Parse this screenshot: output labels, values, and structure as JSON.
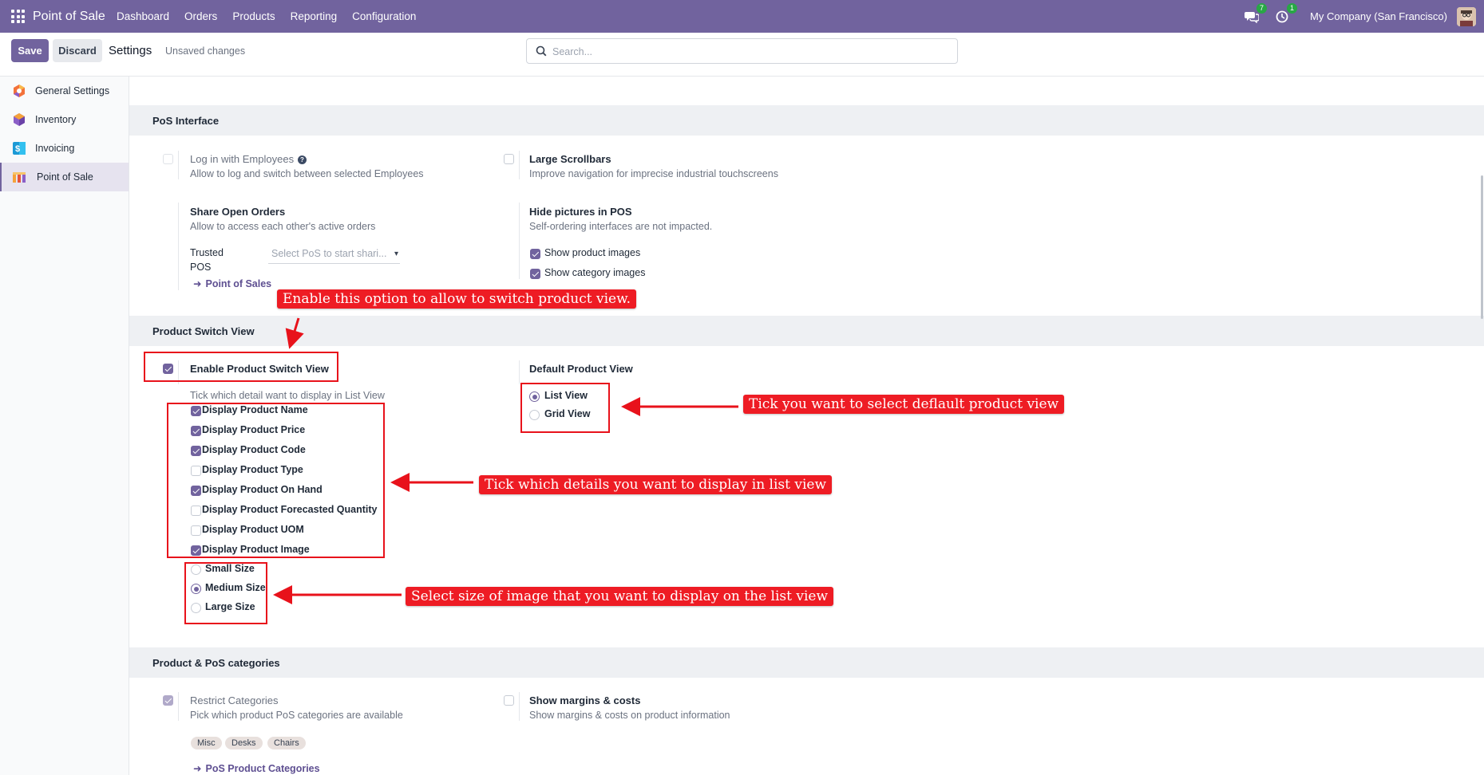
{
  "navbar": {
    "brand": "Point of Sale",
    "menu": [
      "Dashboard",
      "Orders",
      "Products",
      "Reporting",
      "Configuration"
    ],
    "messages_count": "7",
    "activities_count": "1",
    "company": "My Company (San Francisco)"
  },
  "control_panel": {
    "save_label": "Save",
    "discard_label": "Discard",
    "title": "Settings",
    "status": "Unsaved changes",
    "search_placeholder": "Search..."
  },
  "sidebar": {
    "items": [
      {
        "label": "General Settings",
        "icon": "odoo-settings-icon",
        "active": false
      },
      {
        "label": "Inventory",
        "icon": "inventory-icon",
        "active": false
      },
      {
        "label": "Invoicing",
        "icon": "invoicing-icon",
        "active": false
      },
      {
        "label": "Point of Sale",
        "icon": "point-of-sale-icon",
        "active": true
      }
    ]
  },
  "pos_interface": {
    "title": "PoS Interface",
    "login_employees": {
      "label": "Log in with Employees",
      "desc": "Allow to log and switch between selected Employees",
      "checked": false
    },
    "large_scrollbars": {
      "label": "Large Scrollbars",
      "desc": "Improve navigation for imprecise industrial touchscreens",
      "checked": false
    },
    "share_orders": {
      "label": "Share Open Orders",
      "desc": "Allow to access each other's active orders"
    },
    "trusted_pos_label_1": "Trusted",
    "trusted_pos_label_2": "POS",
    "trusted_pos_placeholder": "Select PoS to start shari...",
    "point_of_sales_link": "Point of Sales",
    "hide_pictures": {
      "label": "Hide pictures in POS",
      "desc": "Self-ordering interfaces are not impacted."
    },
    "show_product_images": {
      "label": "Show product images",
      "checked": true
    },
    "show_category_images": {
      "label": "Show category images",
      "checked": true
    }
  },
  "product_switch_view": {
    "title": "Product Switch View",
    "enable": {
      "label": "Enable Product Switch View",
      "checked": true
    },
    "list_hint": "Tick which detail want to display in List View",
    "details": [
      {
        "label": "Display Product Name",
        "checked": true
      },
      {
        "label": "Display Product Price",
        "checked": true
      },
      {
        "label": "Display Product Code",
        "checked": true
      },
      {
        "label": "Display Product Type",
        "checked": false
      },
      {
        "label": "Display Product On Hand",
        "checked": true
      },
      {
        "label": "Display Product Forecasted Quantity",
        "checked": false
      },
      {
        "label": "Display Product UOM",
        "checked": false
      },
      {
        "label": "Display Product Image",
        "checked": true
      }
    ],
    "image_sizes": [
      {
        "label": "Small Size",
        "selected": false
      },
      {
        "label": "Medium Size",
        "selected": true
      },
      {
        "label": "Large Size",
        "selected": false
      }
    ],
    "default_view": {
      "label": "Default Product View",
      "options": [
        {
          "label": "List View",
          "selected": true
        },
        {
          "label": "Grid View",
          "selected": false
        }
      ]
    }
  },
  "categories": {
    "title": "Product & PoS categories",
    "restrict": {
      "label": "Restrict Categories",
      "desc": "Pick which product PoS categories are available",
      "checked": true
    },
    "tags": [
      "Misc",
      "Desks",
      "Chairs"
    ],
    "link": "PoS Product Categories",
    "margins": {
      "label": "Show margins & costs",
      "desc": "Show margins & costs on product information",
      "checked": false
    }
  },
  "annotations": {
    "enable_option": "Enable this option to allow to switch product view.",
    "default_view": "Tick you want to select deflault product view",
    "details": "Tick which details you want to display in list view",
    "image_size": "Select size of image that you want to display on the list view",
    "color": "#ee1c24"
  }
}
